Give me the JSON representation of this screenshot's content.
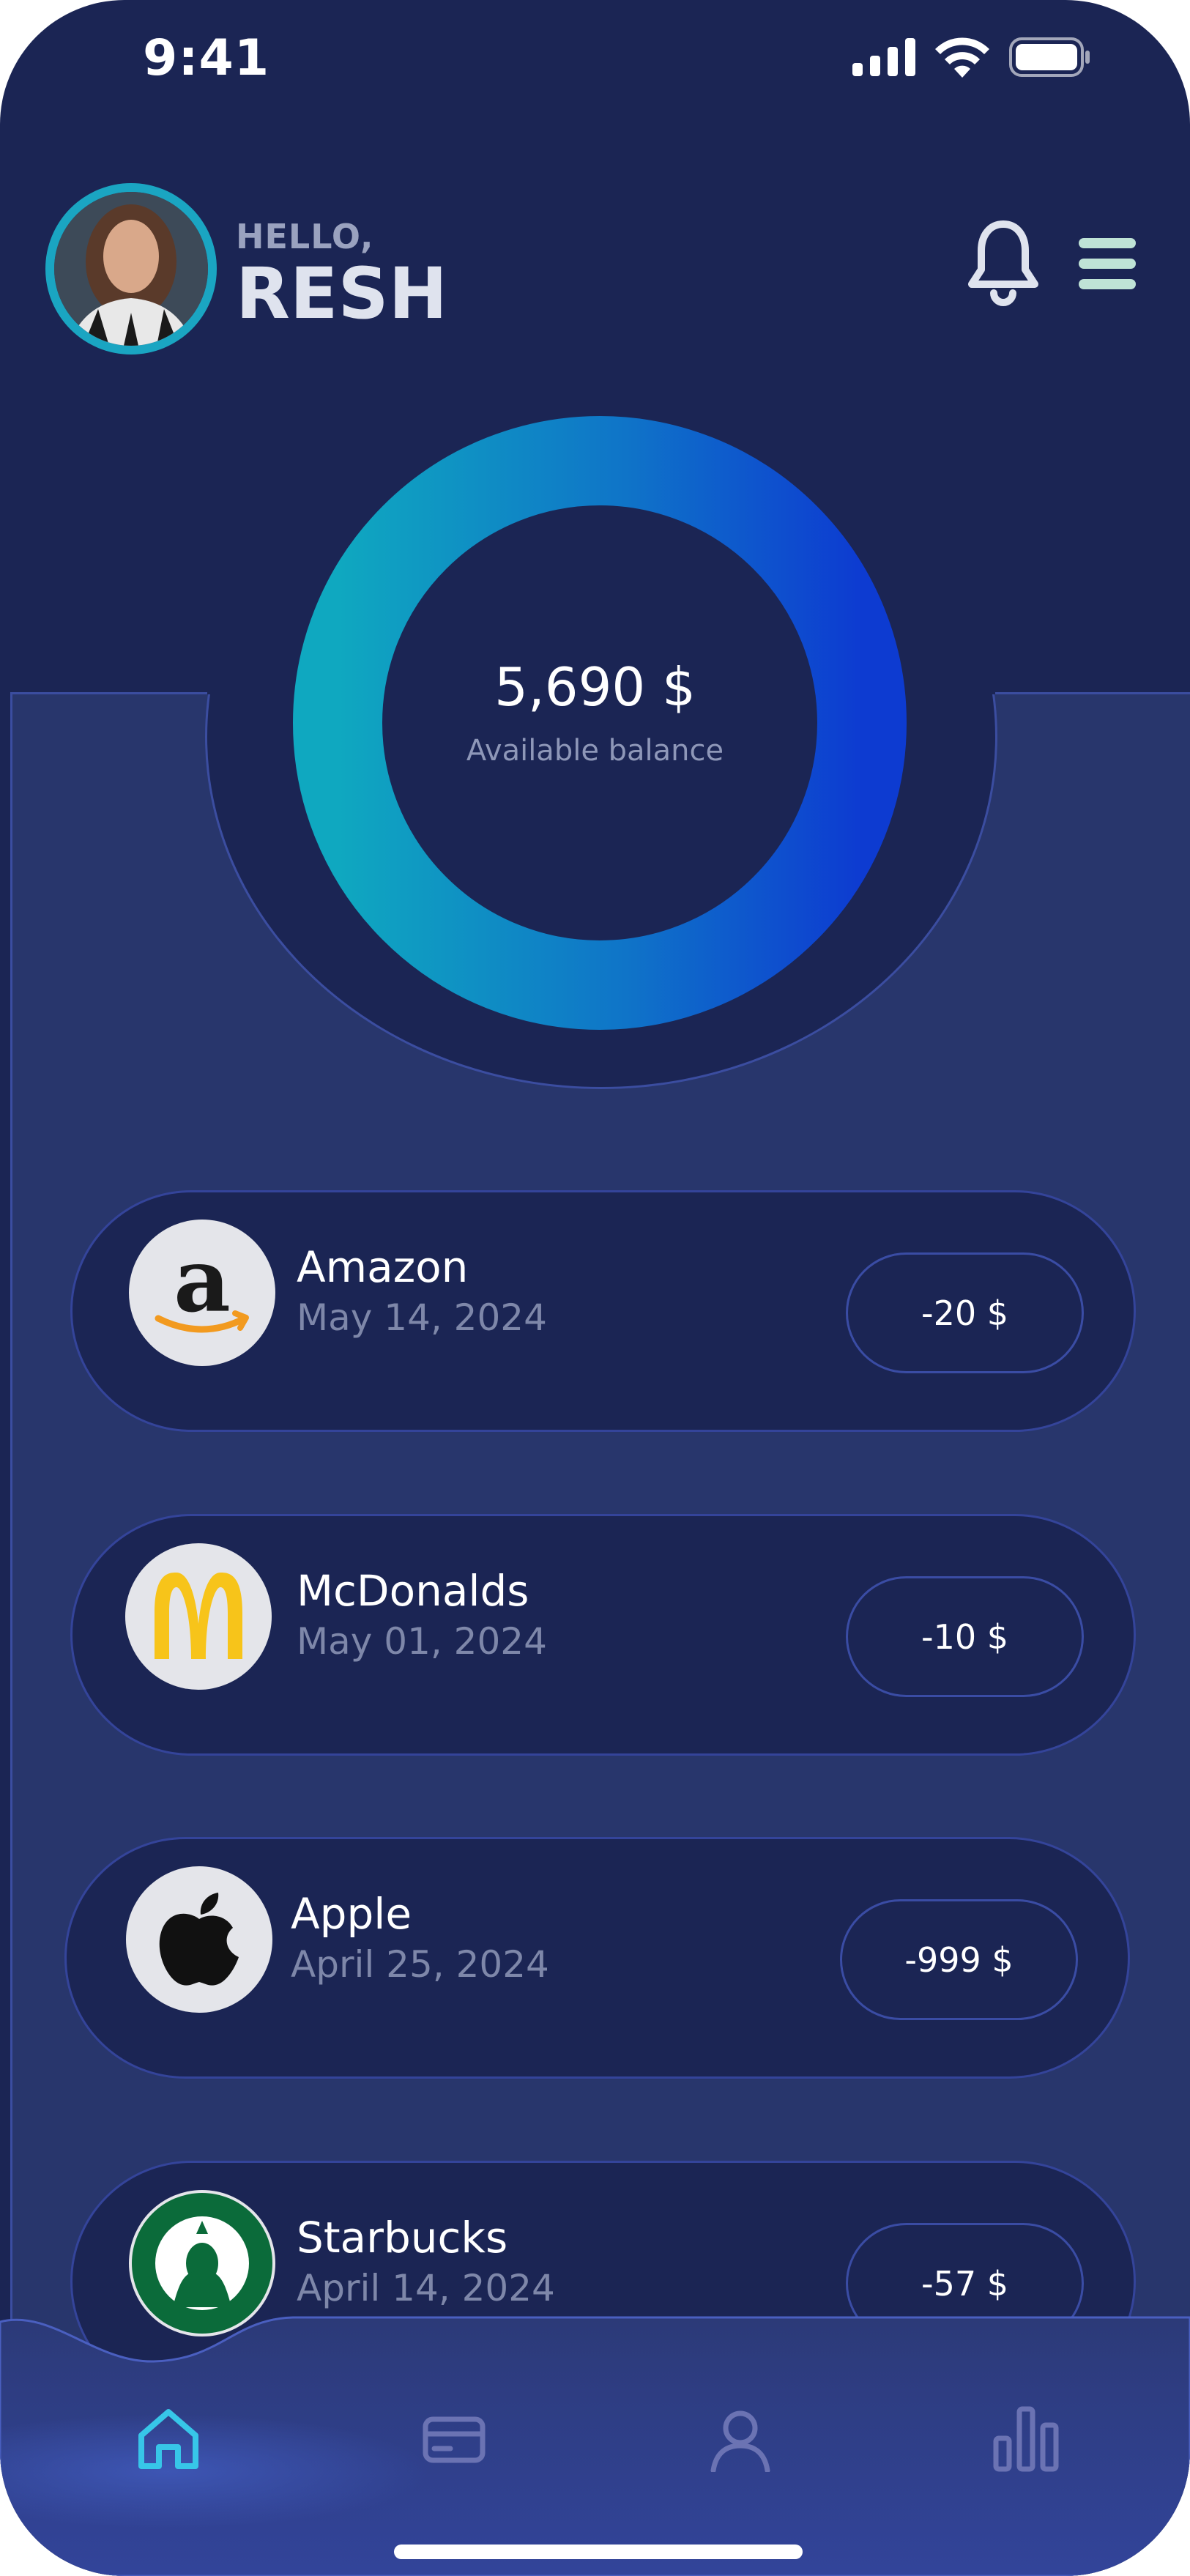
{
  "status_bar": {
    "time": "9:41"
  },
  "header": {
    "greeting": "HELLO,",
    "name": "RESH"
  },
  "balance": {
    "amount": "5,690 $",
    "label": "Available balance"
  },
  "transactions": [
    {
      "merchant": "Amazon",
      "date": "May 14, 2024",
      "amount": "-20 $",
      "logo": "amazon-logo"
    },
    {
      "merchant": "McDonalds",
      "date": "May 01, 2024",
      "amount": "-10 $",
      "logo": "mcdonalds-logo"
    },
    {
      "merchant": "Apple",
      "date": "April 25, 2024",
      "amount": "-999 $",
      "logo": "apple-logo"
    },
    {
      "merchant": "Starbucks",
      "date": "April 14, 2024",
      "amount": "-57 $",
      "logo": "starbucks-logo"
    }
  ],
  "nav": {
    "items": [
      "home-icon",
      "card-icon",
      "profile-icon",
      "stats-icon"
    ],
    "active": "home-icon"
  },
  "colors": {
    "background": "#1b2554",
    "panel": "#28366c",
    "accent": "#19b5d3",
    "donut_start": "#0fa8c0",
    "donut_end": "#0d3bd1",
    "nav_active": "#37c6e8",
    "nav_inactive": "#6b73b3"
  }
}
